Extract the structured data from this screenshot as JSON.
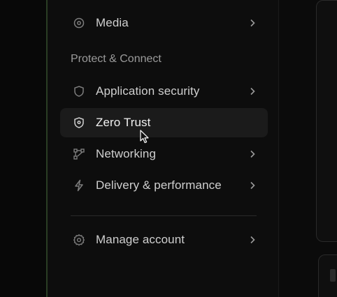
{
  "sidebar": {
    "items": [
      {
        "label": "Media",
        "icon": "media-icon",
        "has_chevron": true
      },
      {
        "label": "Application security",
        "icon": "shield-icon",
        "has_chevron": true
      },
      {
        "label": "Zero Trust",
        "icon": "zero-trust-icon",
        "has_chevron": false,
        "active": true
      },
      {
        "label": "Networking",
        "icon": "network-icon",
        "has_chevron": true
      },
      {
        "label": "Delivery & performance",
        "icon": "bolt-icon",
        "has_chevron": true
      },
      {
        "label": "Manage account",
        "icon": "gear-icon",
        "has_chevron": true
      }
    ],
    "section_heading": "Protect & Connect"
  },
  "colors": {
    "background": "#0b0b0b",
    "sidebar": "#0d0d0d",
    "active_item": "#1b1b1b",
    "divider_green": "#2a3d24",
    "text_primary": "#cfcfcf",
    "text_muted": "#9b9b9b"
  }
}
